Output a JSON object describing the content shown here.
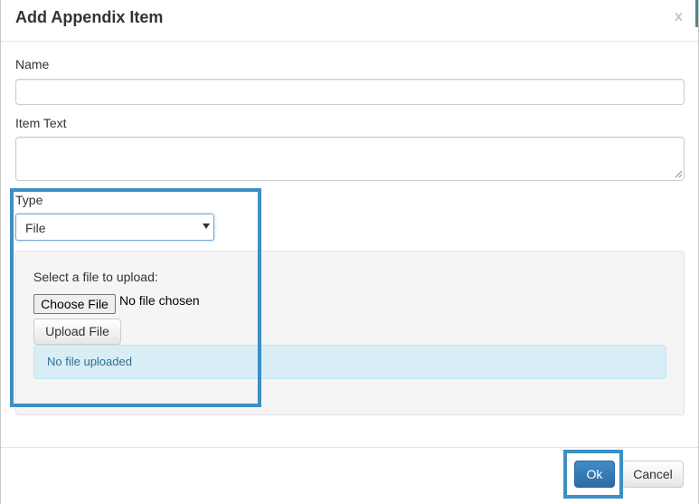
{
  "dialog": {
    "title": "Add Appendix Item",
    "close_label": "x"
  },
  "form": {
    "name_label": "Name",
    "name_value": "",
    "item_text_label": "Item Text",
    "item_text_value": "",
    "type_label": "Type",
    "type_selected": "File"
  },
  "upload": {
    "prompt": "Select a file to upload:",
    "choose_file_label": "Choose File",
    "no_file_chosen": "No file chosen",
    "upload_button_label": "Upload File",
    "status_message": "No file uploaded"
  },
  "footer": {
    "ok_label": "Ok",
    "cancel_label": "Cancel"
  },
  "colors": {
    "highlight": "#3d8fc4",
    "primary": "#428bca",
    "info_bg": "#d9edf7",
    "info_text": "#31708f"
  },
  "icons": {
    "close": "close-icon",
    "dropdown": "chevron-down-icon",
    "resize": "resize-grip-icon"
  }
}
